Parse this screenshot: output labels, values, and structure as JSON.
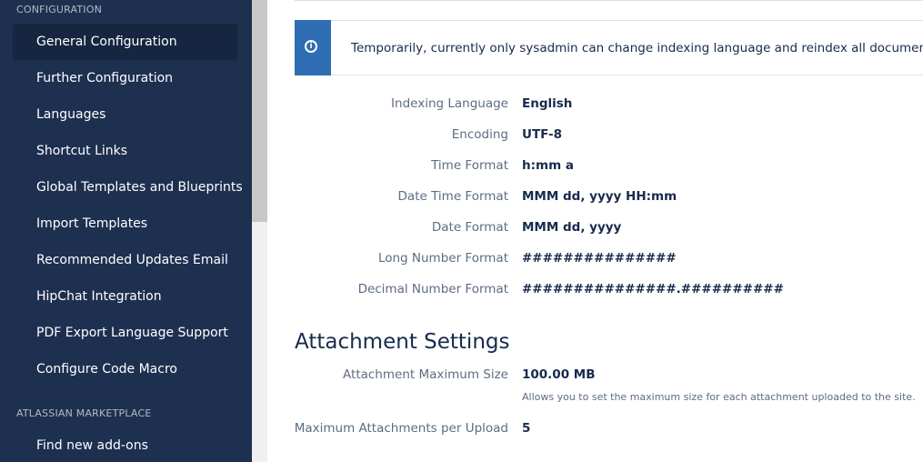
{
  "sidebar": {
    "configuration_heading": "CONFIGURATION",
    "items": [
      {
        "label": "General Configuration",
        "active": true
      },
      {
        "label": "Further Configuration"
      },
      {
        "label": "Languages"
      },
      {
        "label": "Shortcut Links"
      },
      {
        "label": "Global Templates and Blueprints"
      },
      {
        "label": "Import Templates"
      },
      {
        "label": "Recommended Updates Email"
      },
      {
        "label": "HipChat Integration"
      },
      {
        "label": "PDF Export Language Support"
      },
      {
        "label": "Configure Code Macro"
      }
    ],
    "marketplace_heading": "ATLASSIAN MARKETPLACE",
    "marketplace_items": [
      {
        "label": "Find new add-ons"
      }
    ]
  },
  "info_message": {
    "icon": "info-icon",
    "text": "Temporarily, currently only sysadmin can change indexing language and reindex all documents. Contact"
  },
  "formatting": {
    "rows": [
      {
        "label": "Indexing Language",
        "value": "English"
      },
      {
        "label": "Encoding",
        "value": "UTF-8"
      },
      {
        "label": "Time Format",
        "value": "h:mm a"
      },
      {
        "label": "Date Time Format",
        "value": "MMM dd, yyyy HH:mm"
      },
      {
        "label": "Date Format",
        "value": "MMM dd, yyyy"
      },
      {
        "label": "Long Number Format",
        "value": "###############"
      },
      {
        "label": "Decimal Number Format",
        "value": "###############.##########"
      }
    ]
  },
  "attachment_settings": {
    "title": "Attachment Settings",
    "max_size_label": "Attachment Maximum Size",
    "max_size_value": "100.00 MB",
    "max_size_help": "Allows you to set the maximum size for each attachment uploaded to the site.",
    "max_per_upload_label": "Maximum Attachments per Upload",
    "max_per_upload_value": "5"
  },
  "colors": {
    "sidebar_bg": "#1e3050",
    "active_item_bg": "#162640",
    "info_stripe": "#2f6db5"
  }
}
